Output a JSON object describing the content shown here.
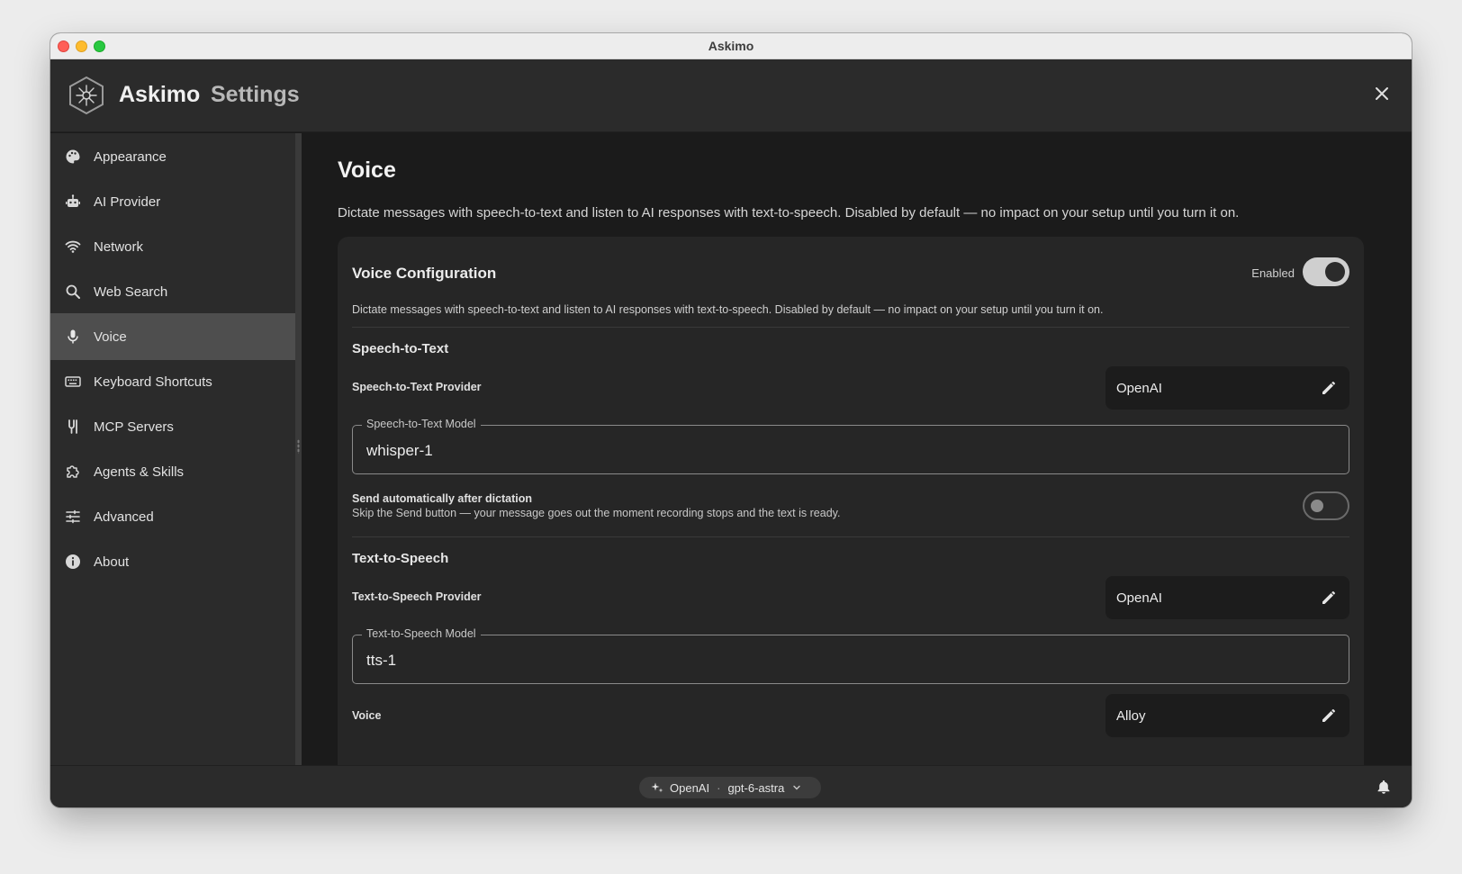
{
  "window": {
    "title": "Askimo"
  },
  "header": {
    "app_name": "Askimo",
    "settings_label": "Settings"
  },
  "sidebar": {
    "items": [
      {
        "label": "Appearance",
        "icon": "palette-icon"
      },
      {
        "label": "AI Provider",
        "icon": "robot-icon"
      },
      {
        "label": "Network",
        "icon": "wifi-icon"
      },
      {
        "label": "Web Search",
        "icon": "search-icon"
      },
      {
        "label": "Voice",
        "icon": "microphone-icon",
        "active": true
      },
      {
        "label": "Keyboard Shortcuts",
        "icon": "keyboard-icon"
      },
      {
        "label": "MCP Servers",
        "icon": "plug-icon"
      },
      {
        "label": "Agents & Skills",
        "icon": "puzzle-icon"
      },
      {
        "label": "Advanced",
        "icon": "sliders-icon"
      },
      {
        "label": "About",
        "icon": "info-icon"
      }
    ]
  },
  "main": {
    "title": "Voice",
    "description": "Dictate messages with speech-to-text and listen to AI responses with text-to-speech. Disabled by default — no impact on your setup until you turn it on.",
    "card": {
      "title": "Voice Configuration",
      "enabled_label": "Enabled",
      "enabled": true,
      "description": "Dictate messages with speech-to-text and listen to AI responses with text-to-speech. Disabled by default — no impact on your setup until you turn it on.",
      "stt": {
        "section_title": "Speech-to-Text",
        "provider_label": "Speech-to-Text Provider",
        "provider_value": "OpenAI",
        "model_label": "Speech-to-Text Model",
        "model_value": "whisper-1",
        "auto_send_title": "Send automatically after dictation",
        "auto_send_desc": "Skip the Send button — your message goes out the moment recording stops and the text is ready.",
        "auto_send": false
      },
      "tts": {
        "section_title": "Text-to-Speech",
        "provider_label": "Text-to-Speech Provider",
        "provider_value": "OpenAI",
        "model_label": "Text-to-Speech Model",
        "model_value": "tts-1",
        "voice_label": "Voice",
        "voice_value": "Alloy"
      }
    }
  },
  "bottombar": {
    "provider": "OpenAI",
    "separator": "·",
    "model": "gpt-6-astra"
  },
  "colors": {
    "background": "#1b1b1b",
    "panel": "#2b2b2b",
    "card": "#262626",
    "active_nav": "#4e4e4e"
  }
}
